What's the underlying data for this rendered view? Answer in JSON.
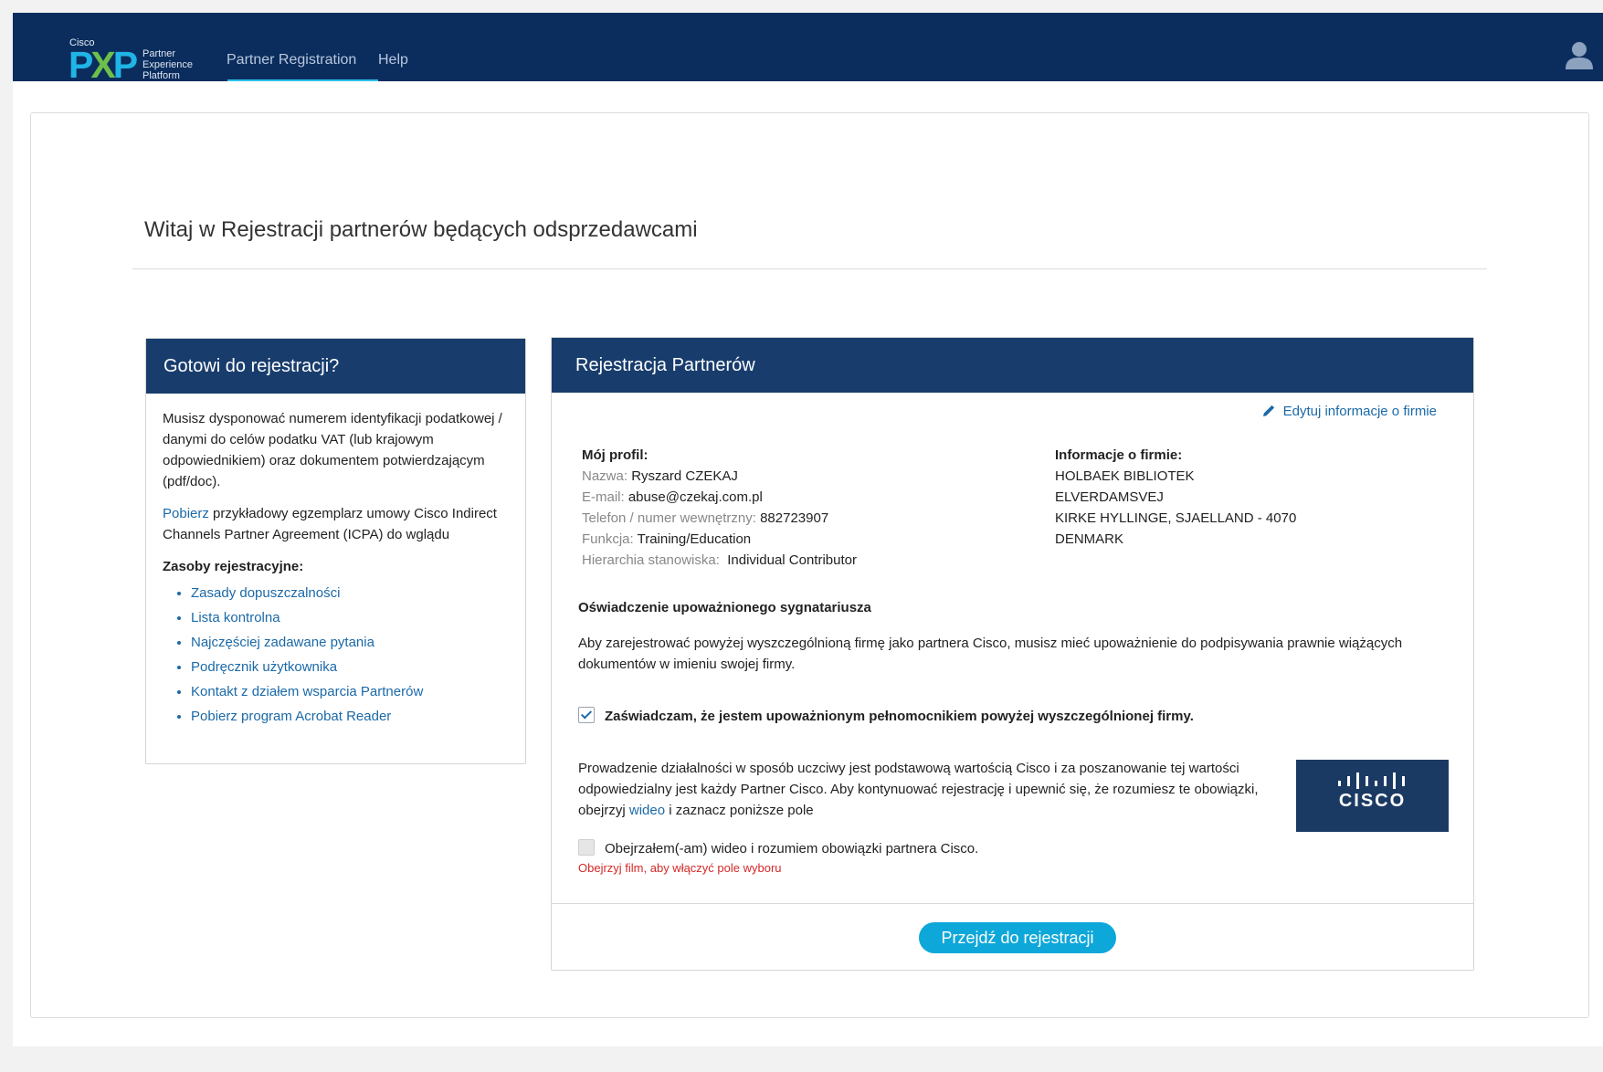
{
  "header": {
    "logo_cisco": "Cisco",
    "logo_pxp_p1": "P",
    "logo_pxp_x": "X",
    "logo_pxp_p2": "P",
    "logo_sub_1": "Partner",
    "logo_sub_2": "Experience",
    "logo_sub_3": "Platform",
    "nav": [
      "Partner Registration",
      "Help"
    ],
    "user_icon": "user-icon"
  },
  "page_title": "Witaj w Rejestracji partnerów będących odsprzedawcami",
  "left": {
    "heading": "Gotowi do rejestracji?",
    "intro": "Musisz dysponować numerem identyfikacji podatkowej / danymi do celów podatku VAT (lub krajowym odpowiednikiem) oraz dokumentem potwierdzającym (pdf/doc).",
    "download_link": "Pobierz",
    "download_text": " przykładowy egzemplarz umowy Cisco Indirect Channels Partner Agreement (ICPA) do wglądu",
    "resources_title": "Zasoby rejestracyjne:",
    "resources": [
      "Zasady dopuszczalności",
      "Lista kontrolna",
      "Najczęściej zadawane pytania",
      "Podręcznik użytkownika",
      "Kontakt z działem wsparcia Partnerów",
      "Pobierz program Acrobat Reader"
    ]
  },
  "right": {
    "heading": "Rejestracja Partnerów",
    "edit_link": "Edytuj informacje o firmie",
    "profile": {
      "title": "Mój profil:",
      "name_label": "Nazwa:",
      "name": "Ryszard CZEKAJ",
      "email_label": "E-mail:",
      "email": "abuse@czekaj.com.pl",
      "phone_label": "Telefon / numer wewnętrzny:",
      "phone": "882723907",
      "role_label": "Funkcja:",
      "role": "Training/Education",
      "hierarchy_label": "Hierarchia stanowiska:",
      "hierarchy": "Individual Contributor"
    },
    "company": {
      "title": "Informacje o firmie:",
      "lines": [
        "HOLBAEK BIBLIOTEK",
        "ELVERDAMSVEJ",
        "KIRKE HYLLINGE, SJAELLAND - 4070",
        "DENMARK"
      ]
    },
    "signatory_title": "Oświadczenie upoważnionego sygnatariusza",
    "signatory_text": "Aby zarejestrować powyżej wyszczególnioną firmę jako partnera Cisco, musisz mieć upoważnienie do podpisywania prawnie wiążących dokumentów w imieniu swojej firmy.",
    "signatory_checkbox": "Zaświadczam, że jestem upoważnionym pełnomocnikiem powyżej wyszczególnionej firmy.",
    "signatory_checked": true,
    "ethics_text_1": "Prowadzenie działalności w sposób uczciwy jest podstawową wartością Cisco i za poszanowanie tej wartości odpowiedzialny jest każdy Partner Cisco. Aby kontynuować rejestrację i upewnić się, że rozumiesz te obowiązki, obejrzyj ",
    "ethics_link": "wideo",
    "ethics_text_2": " i zaznacz poniższe pole",
    "video_logo_text": "CISCO",
    "video_checkbox": "Obejrzałem(-am) wideo i rozumiem obowiązki partnera Cisco.",
    "video_warning": "Obejrzyj film, aby włączyć pole wyboru",
    "submit": "Przejdź do rejestracji"
  },
  "colors": {
    "header_bg": "#0b2d5e",
    "card_head_bg": "#183d6d",
    "accent": "#0ea7d9",
    "link": "#1b69a8",
    "warning": "#d62828"
  }
}
